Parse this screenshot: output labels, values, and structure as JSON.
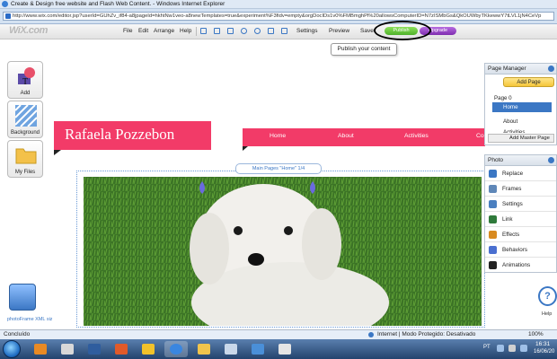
{
  "window": {
    "title": "Create & Design free website and Flash Web Content. - Windows Internet Explorer",
    "url": "http://www.wix.com/editor.jsp?userId=GUhZv_if84-a8jpageId=hkhtNw1veo-a8newTemplates=true&experiment%F3fidv=empty&orgDocIDs1v0%FMBmghPl%20allowsComputerID=N7zISMbGs&QkOUWbyTKkewwY7tLVL1jN4CeVp"
  },
  "editor": {
    "logo": "WiX.com",
    "menu": [
      "File",
      "Edit",
      "Arrange",
      "Help"
    ],
    "settings_label": "Settings",
    "preview_label": "Preview",
    "save_label": "Save",
    "publish_label": "Publish",
    "upgrade_label": "Upgrade",
    "publish_tooltip": "Publish your content"
  },
  "left_panel": {
    "add_label": "Add",
    "background_label": "Background",
    "myfiles_label": "My Files",
    "photo_label": "photoFrame XML size: 16k"
  },
  "site": {
    "title": "Rafaela Pozzebon",
    "nav": [
      "Home",
      "About",
      "Activities",
      "Co"
    ],
    "gallery_label": "Main Pages \"Home\" 1/4"
  },
  "page_manager": {
    "header": "Page Manager",
    "add_page_label": "Add Page",
    "pages": [
      "Page 0",
      "Home",
      "About",
      "Activities"
    ],
    "selected": "Home",
    "add_master_label": "Add Master Page"
  },
  "photo_panel": {
    "header": "Photo",
    "items": [
      {
        "label": "Replace",
        "color": "#3b77c4"
      },
      {
        "label": "Frames",
        "color": "#5f87b8"
      },
      {
        "label": "Settings",
        "color": "#4a7fc0"
      },
      {
        "label": "Link",
        "color": "#2f7a3b"
      },
      {
        "label": "Effects",
        "color": "#d88a20"
      },
      {
        "label": "Behaviors",
        "color": "#4a6fd0"
      },
      {
        "label": "Animations",
        "color": "#222222"
      }
    ],
    "help_label": "Help"
  },
  "statusbar": {
    "left": "Concluído",
    "right": "Internet | Modo Protegido: Desativado",
    "zoom": "100%"
  },
  "taskbar": {
    "lang": "PT",
    "time": "16:31",
    "date": "16/06/20"
  }
}
